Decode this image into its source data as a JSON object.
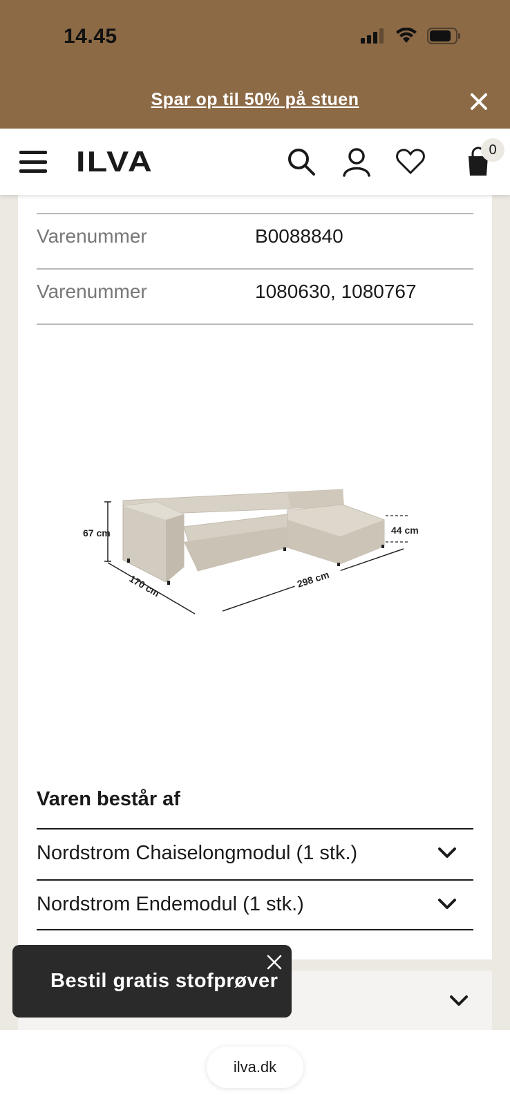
{
  "status_bar": {
    "time": "14.45"
  },
  "promo": {
    "text": "Spar op til 50% på stuen"
  },
  "header": {
    "logo": "ILVA",
    "cart_count": "0"
  },
  "specs": [
    {
      "label": "Varenummer",
      "value": "B0088840"
    },
    {
      "label": "Varenummer",
      "value": "1080630, 1080767"
    }
  ],
  "dimensions": {
    "height": "67 cm",
    "depth": "170 cm",
    "width": "298 cm",
    "seat_height": "44 cm"
  },
  "consists_of": {
    "title": "Varen består af",
    "items": [
      {
        "label": "Nordstrom Chaiselongmodul (1 stk.)"
      },
      {
        "label": "Nordstrom Endemodul (1 stk.)"
      }
    ]
  },
  "toast": {
    "text": "Bestil gratis stofprøver"
  },
  "browser": {
    "url": "ilva.dk"
  }
}
